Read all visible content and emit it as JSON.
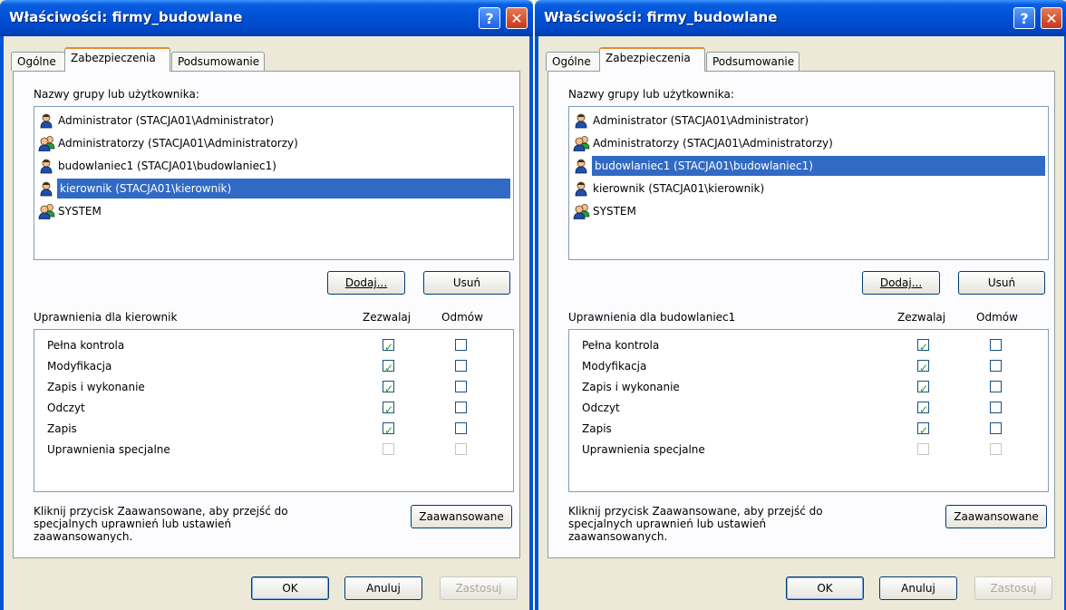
{
  "windows": [
    {
      "title": "Właściwości: firmy_budowlane",
      "tabs": [
        "Ogólne",
        "Zabezpieczenia",
        "Podsumowanie"
      ],
      "users_label": "Nazwy grupy lub użytkownika:",
      "users": [
        {
          "name": "Administrator (STACJA01\\Administrator)",
          "icon": "user-icon",
          "selected": false
        },
        {
          "name": "Administratorzy (STACJA01\\Administratorzy)",
          "icon": "group-icon",
          "selected": false
        },
        {
          "name": "budowlaniec1 (STACJA01\\budowlaniec1)",
          "icon": "user-icon",
          "selected": false
        },
        {
          "name": "kierownik (STACJA01\\kierownik)",
          "icon": "user-icon",
          "selected": true
        },
        {
          "name": "SYSTEM",
          "icon": "group-icon",
          "selected": false
        }
      ],
      "add_label": "Dodaj...",
      "remove_label": "Usuń",
      "perm_label": "Uprawnienia dla kierownik",
      "allow_header": "Zezwalaj",
      "deny_header": "Odmów",
      "permissions": [
        {
          "name": "Pełna kontrola",
          "allow": true,
          "deny": false,
          "disabled": false
        },
        {
          "name": "Modyfikacja",
          "allow": true,
          "deny": false,
          "disabled": false
        },
        {
          "name": "Zapis i wykonanie",
          "allow": true,
          "deny": false,
          "disabled": false
        },
        {
          "name": "Odczyt",
          "allow": true,
          "deny": false,
          "disabled": false
        },
        {
          "name": "Zapis",
          "allow": true,
          "deny": false,
          "disabled": false
        },
        {
          "name": "Uprawnienia specjalne",
          "allow": false,
          "deny": false,
          "disabled": true
        }
      ],
      "hint": [
        "Kliknij przycisk Zaawansowane, aby przejść do",
        "specjalnych uprawnień lub ustawień",
        "zaawansowanych."
      ],
      "advanced_label": "Zaawansowane",
      "ok_label": "OK",
      "cancel_label": "Anuluj",
      "apply_label": "Zastosuj"
    },
    {
      "title": "Właściwości: firmy_budowlane",
      "tabs": [
        "Ogólne",
        "Zabezpieczenia",
        "Podsumowanie"
      ],
      "users_label": "Nazwy grupy lub użytkownika:",
      "users": [
        {
          "name": "Administrator (STACJA01\\Administrator)",
          "icon": "user-icon",
          "selected": false
        },
        {
          "name": "Administratorzy (STACJA01\\Administratorzy)",
          "icon": "group-icon",
          "selected": false
        },
        {
          "name": "budowlaniec1 (STACJA01\\budowlaniec1)",
          "icon": "user-icon",
          "selected": true
        },
        {
          "name": "kierownik (STACJA01\\kierownik)",
          "icon": "user-icon",
          "selected": false
        },
        {
          "name": "SYSTEM",
          "icon": "group-icon",
          "selected": false
        }
      ],
      "add_label": "Dodaj...",
      "remove_label": "Usuń",
      "perm_label": "Uprawnienia dla budowlaniec1",
      "allow_header": "Zezwalaj",
      "deny_header": "Odmów",
      "permissions": [
        {
          "name": "Pełna kontrola",
          "allow": true,
          "deny": false,
          "disabled": false
        },
        {
          "name": "Modyfikacja",
          "allow": true,
          "deny": false,
          "disabled": false
        },
        {
          "name": "Zapis i wykonanie",
          "allow": true,
          "deny": false,
          "disabled": false
        },
        {
          "name": "Odczyt",
          "allow": true,
          "deny": false,
          "disabled": false
        },
        {
          "name": "Zapis",
          "allow": true,
          "deny": false,
          "disabled": false
        },
        {
          "name": "Uprawnienia specjalne",
          "allow": false,
          "deny": false,
          "disabled": true
        }
      ],
      "hint": [
        "Kliknij przycisk Zaawansowane, aby przejść do",
        "specjalnych uprawnień lub ustawień",
        "zaawansowanych."
      ],
      "advanced_label": "Zaawansowane",
      "ok_label": "OK",
      "cancel_label": "Anuluj",
      "apply_label": "Zastosuj"
    }
  ],
  "colors": {
    "selection": "#316ac5",
    "titlebar": "#0052d6",
    "dialog_bg": "#ece9d8",
    "check": "#21a121",
    "tab_accent": "#e68b2c"
  }
}
